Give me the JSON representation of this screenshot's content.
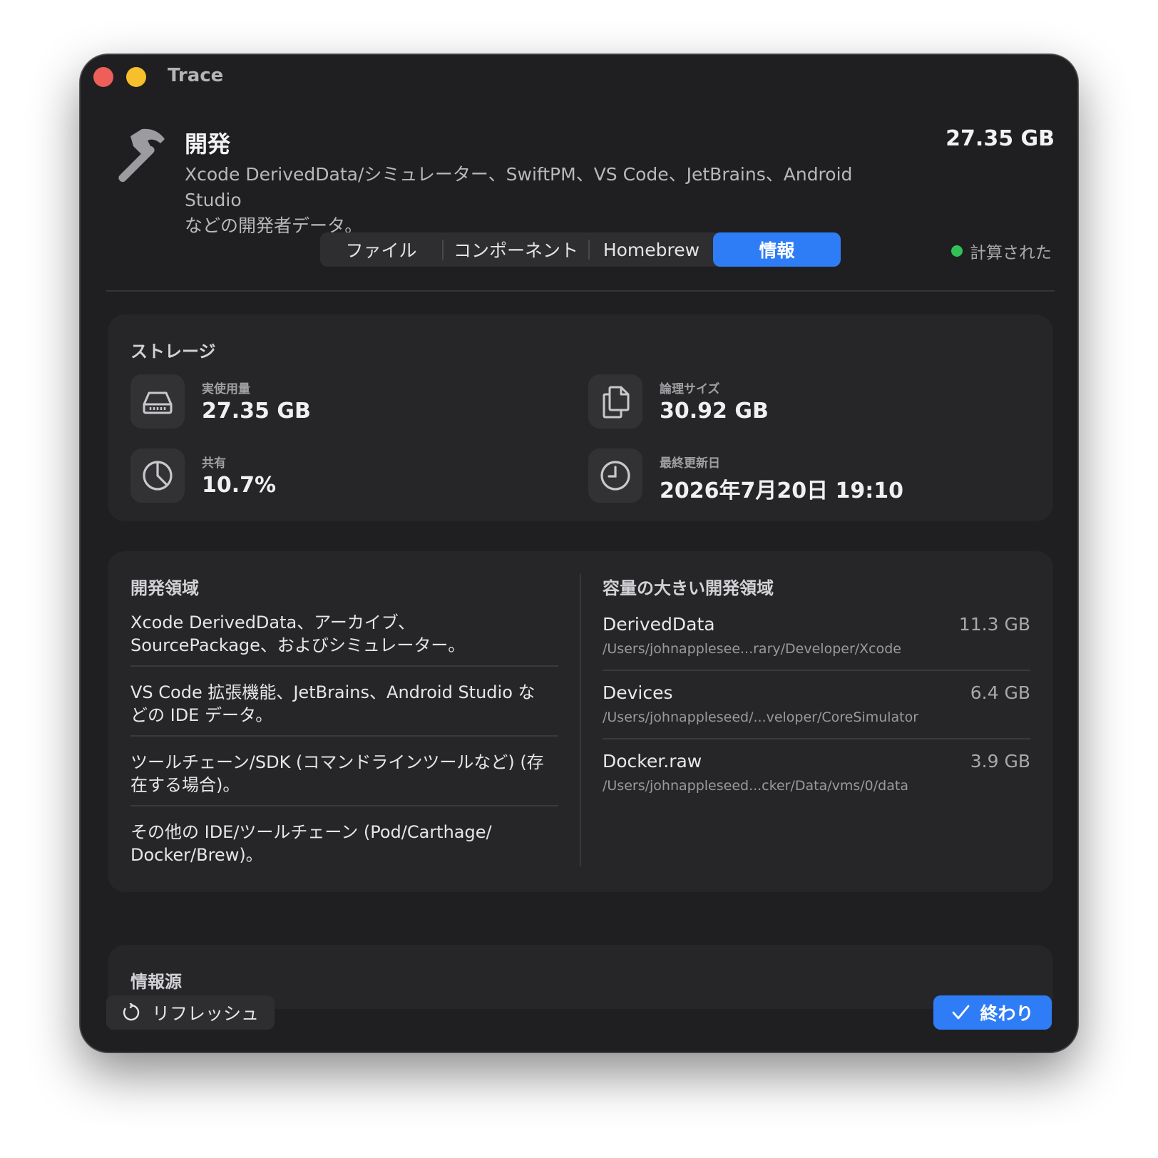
{
  "window": {
    "title": "Trace"
  },
  "category": {
    "icon": "hammer-icon",
    "title": "開発",
    "description_line1": "Xcode DerivedData/シミュレーター、SwiftPM、VS Code、JetBrains、Android Studio",
    "description_line2": "などの開発者データ。",
    "total_size": "27.35 GB"
  },
  "tabs": [
    {
      "label": "ファイル",
      "active": false
    },
    {
      "label": "コンポーネント",
      "active": false
    },
    {
      "label": "Homebrew",
      "active": false
    },
    {
      "label": "情報",
      "active": true
    }
  ],
  "status": {
    "label": "計算された",
    "color": "#30c254"
  },
  "storage": {
    "heading": "ストレージ",
    "actual_usage": {
      "icon": "drive-icon",
      "label": "実使用量",
      "value": "27.35 GB"
    },
    "logical_size": {
      "icon": "documents-icon",
      "label": "論理サイズ",
      "value": "30.92 GB"
    },
    "shared": {
      "icon": "pie-chart-icon",
      "label": "共有",
      "value": "10.7%"
    },
    "last_modified": {
      "icon": "clock-icon",
      "label": "最終更新日",
      "value": "2026年7月20日 19:10"
    }
  },
  "dev_areas": {
    "heading": "開発領域",
    "items": [
      {
        "line1": "Xcode DerivedData、アーカイブ、",
        "line2": "SourcePackage、およびシミュレーター。"
      },
      {
        "line1": "VS Code 拡張機能、JetBrains、Android Studio な",
        "line2": "どの IDE データ。"
      },
      {
        "line1": "ツールチェーン/SDK (コマンドラインツールなど) (存",
        "line2": "在する場合)。"
      },
      {
        "line1": "その他の IDE/ツールチェーン (Pod/Carthage/",
        "line2": "Docker/Brew)。"
      }
    ]
  },
  "large_areas": {
    "heading": "容量の大きい開発領域",
    "items": [
      {
        "name": "DerivedData",
        "size": "11.3 GB",
        "path": "/Users/johnapplesee...rary/Developer/Xcode"
      },
      {
        "name": "Devices",
        "size": "6.4 GB",
        "path": "/Users/johnappleseed/...veloper/CoreSimulator"
      },
      {
        "name": "Docker.raw",
        "size": "3.9 GB",
        "path": "/Users/johnappleseed...cker/Data/vms/0/data"
      }
    ]
  },
  "sources": {
    "heading": "情報源"
  },
  "footer": {
    "refresh": {
      "icon": "refresh-icon",
      "label": "リフレッシュ"
    },
    "done": {
      "icon": "checkmark-icon",
      "label": "終わり"
    }
  },
  "colors": {
    "accent": "#2f7df6",
    "window_bg": "#1f1f21",
    "panel_bg": "#262628"
  }
}
